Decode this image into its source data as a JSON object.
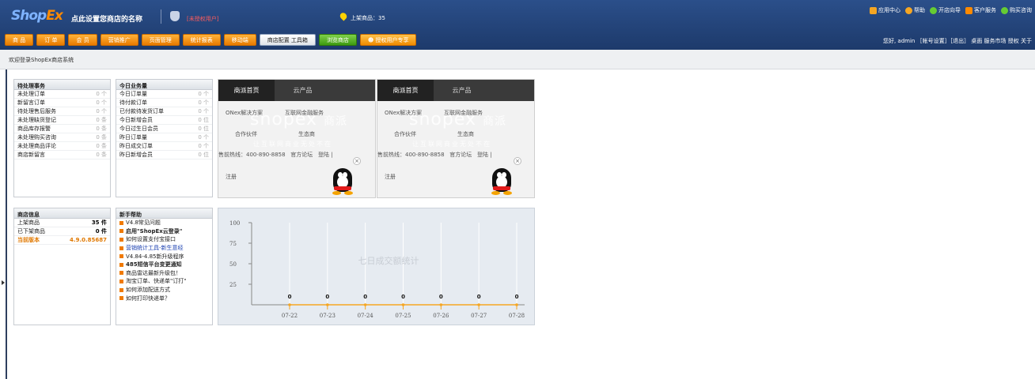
{
  "header": {
    "logo_left": "ShopEx",
    "shop_name": "点此设置您商店的名称",
    "license": "[未授权用户]",
    "on_sale": "上架商品：35",
    "top_links": [
      {
        "icon": "app-center-icon",
        "color": "#f5a623",
        "label": "应用中心"
      },
      {
        "icon": "help-icon",
        "color": "#f5a623",
        "label": "帮助"
      },
      {
        "icon": "guide-icon",
        "color": "#66cc33",
        "label": "开店向导"
      },
      {
        "icon": "service-icon",
        "color": "#ff8a00",
        "label": "客户服务"
      },
      {
        "icon": "consult-icon",
        "color": "#66cc33",
        "label": "购买咨询"
      }
    ],
    "nav": [
      "商 品",
      "订 单",
      "会 员",
      "营销推广",
      "页面管理",
      "统计报表",
      "移动端"
    ],
    "nav_tools": "商店配置 工具箱",
    "nav_browse": "浏览商店",
    "nav_exclusive": "授权用户专享",
    "user_line": "您好, admin ［帐号设置］［退出］ 桌面  服务市场  授权  关于"
  },
  "welcome": "欢迎登录ShopEx商店系统",
  "pending": {
    "title": "待处理事务",
    "rows": [
      {
        "k": "未处理订单",
        "v": "0 个"
      },
      {
        "k": "新留言订单",
        "v": "0 个"
      },
      {
        "k": "待处理售后服务",
        "v": "0 个"
      },
      {
        "k": "未处理缺货登记",
        "v": "0 条"
      },
      {
        "k": "商品库存报警",
        "v": "0 条"
      },
      {
        "k": "未处理购买咨询",
        "v": "0 条"
      },
      {
        "k": "未处理商品评论",
        "v": "0 条"
      },
      {
        "k": "商店新留言",
        "v": "0 条"
      }
    ]
  },
  "today": {
    "title": "今日业务量",
    "rows": [
      {
        "k": "今日订单量",
        "v": "0 个"
      },
      {
        "k": "待付款订单",
        "v": "0 个"
      },
      {
        "k": "已付款待发货订单",
        "v": "0 个"
      },
      {
        "k": "今日新增会员",
        "v": "0 位"
      },
      {
        "k": "今日过生日会员",
        "v": "0 位"
      },
      {
        "k": "昨日订单量",
        "v": "0 个"
      },
      {
        "k": "昨日成交订单",
        "v": "0 个"
      },
      {
        "k": "昨日新增会员",
        "v": "0 位"
      }
    ]
  },
  "shopinfo": {
    "title": "商店信息",
    "rows": [
      {
        "k": "上架商品",
        "v": "35 件"
      },
      {
        "k": "已下架商品",
        "v": "0 件"
      },
      {
        "k": "当前版本",
        "v": "4.9.0.85687"
      }
    ]
  },
  "help": {
    "title": "新手帮助",
    "items": [
      "V4.8常见问题",
      "启用\"ShopEx云登录\"",
      "如何设置支付宝接口",
      "营销统计工具-新生意经",
      "V4.84-4.85新升级程序",
      "485短信平台变更通知",
      "商品雷达最新升级包！",
      "淘宝订单、快递单\"订打\"",
      "如何添加配送方式",
      "如何打印快递单？"
    ]
  },
  "promo": {
    "tab_home": "商派首页",
    "tab_cloud": "云产品",
    "link1": "ONex解决方案",
    "link2": "互联网金融服务",
    "link3": "合作伙伴",
    "link4": "生态商",
    "brand_cn": "商派",
    "slogan": "让互联网商业无处不在",
    "hotline": "售前热线：400-890-8858",
    "forum": "官方论坛",
    "login": "登陆",
    "register": "注册"
  },
  "chart_data": {
    "type": "line",
    "title": "七日成交额统计",
    "categories": [
      "07-22",
      "07-23",
      "07-24",
      "07-25",
      "07-26",
      "07-27",
      "07-28"
    ],
    "values": [
      0,
      0,
      0,
      0,
      0,
      0,
      0
    ],
    "yticks": [
      "100",
      "75",
      "50",
      "25"
    ],
    "ylim": [
      0,
      100
    ],
    "line_color": "#f5a623"
  }
}
